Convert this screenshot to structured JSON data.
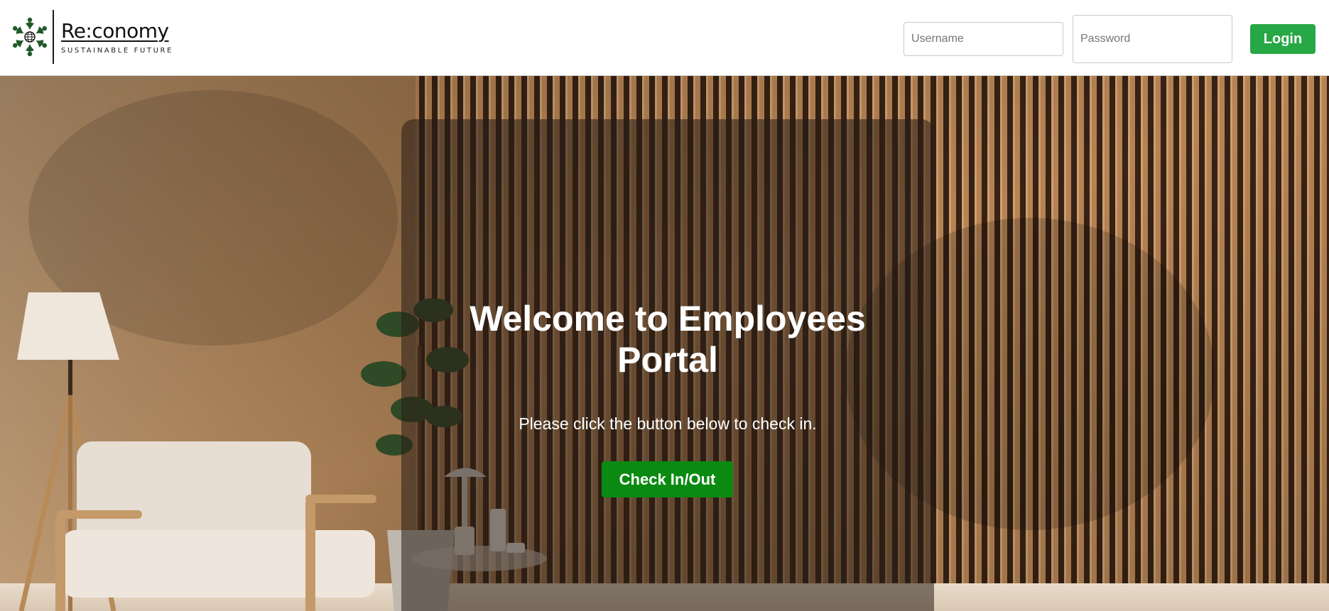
{
  "header": {
    "brand_name": "Re:conomy",
    "brand_tagline": "SUSTAINABLE FUTURE",
    "username_placeholder": "Username",
    "username_value": "",
    "password_placeholder": "Password",
    "password_value": "",
    "login_label": "Login",
    "logo_icon": "globe-people-icon"
  },
  "hero": {
    "title_line1": "Welcome to Employees",
    "title_line2": "Portal",
    "subtitle": "Please click the button below to check in.",
    "checkin_label": "Check In/Out",
    "background": "interior-photo"
  },
  "colors": {
    "login_button": "#27a745",
    "checkin_button": "#0b8a12",
    "logo_green": "#1f5a2a"
  }
}
